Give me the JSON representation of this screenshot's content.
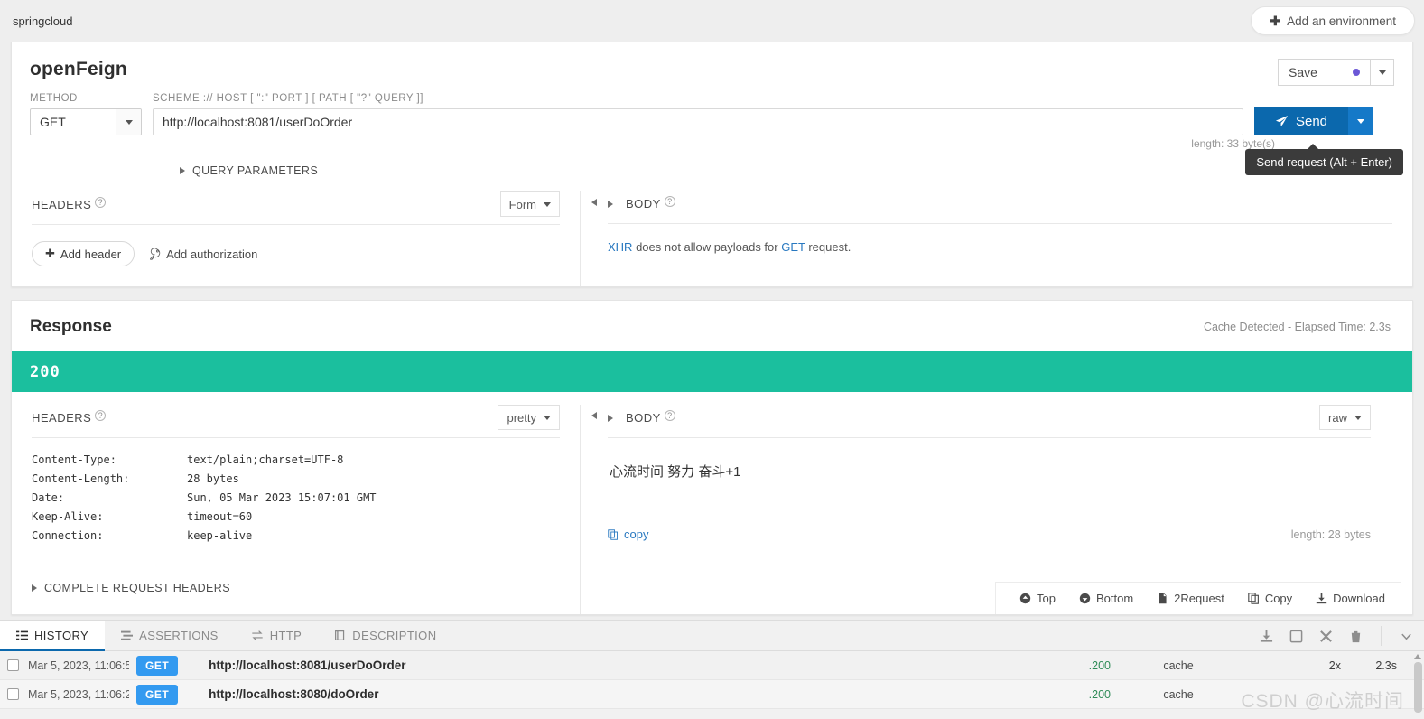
{
  "topbar": {
    "workspace": "springcloud",
    "add_environment": "Add an environment"
  },
  "request": {
    "title": "openFeign",
    "save_label": "Save",
    "method_label": "METHOD",
    "method_value": "GET",
    "url_label": "SCHEME :// HOST [ \":\" PORT ] [ PATH [ \"?\" QUERY ]]",
    "url_value": "http://localhost:8081/userDoOrder",
    "send_label": "Send",
    "send_tooltip": "Send request (Alt + Enter)",
    "length_note": "length: 33 byte(s)",
    "query_parameters": "QUERY PARAMETERS",
    "headers": {
      "title": "HEADERS",
      "view_mode": "Form",
      "add_header": "Add header",
      "add_authorization": "Add authorization"
    },
    "body": {
      "title": "BODY",
      "note_prefix": "XHR",
      "note_middle": " does not allow payloads for ",
      "note_method": "GET",
      "note_suffix": " request."
    }
  },
  "response": {
    "title": "Response",
    "meta": "Cache Detected - Elapsed Time: 2.3s",
    "status_code": "200",
    "headers": {
      "title": "HEADERS",
      "view_mode": "pretty",
      "rows": [
        {
          "key": "Content-Type:",
          "value": "text/plain;charset=UTF-8"
        },
        {
          "key": "Content-Length:",
          "value": "28 bytes"
        },
        {
          "key": "Date:",
          "value": "Sun, 05 Mar 2023 15:07:01 GMT"
        },
        {
          "key": "Keep-Alive:",
          "value": "timeout=60"
        },
        {
          "key": "Connection:",
          "value": "keep-alive"
        }
      ],
      "complete_request_headers": "COMPLETE REQUEST HEADERS"
    },
    "body": {
      "title": "BODY",
      "view_mode": "raw",
      "content": "心流时间 努力 奋斗+1",
      "copy_label": "copy",
      "length": "length: 28 bytes"
    },
    "footer": [
      {
        "label": "Top",
        "icon": "arrow-up-circle-icon"
      },
      {
        "label": "Bottom",
        "icon": "arrow-down-circle-icon"
      },
      {
        "label": "2Request",
        "icon": "request-icon"
      },
      {
        "label": "Copy",
        "icon": "copy-icon"
      },
      {
        "label": "Download",
        "icon": "download-icon"
      }
    ]
  },
  "history": {
    "tabs": [
      {
        "label": "HISTORY",
        "icon": "list-icon",
        "active": true
      },
      {
        "label": "ASSERTIONS",
        "icon": "assertions-icon",
        "active": false
      },
      {
        "label": "HTTP",
        "icon": "exchange-icon",
        "active": false
      },
      {
        "label": "DESCRIPTION",
        "icon": "book-icon",
        "active": false
      }
    ],
    "tools": [
      "download-icon",
      "select-all-icon",
      "clear-icon",
      "trash-icon",
      "chevron-down-icon"
    ],
    "rows": [
      {
        "time": "Mar 5, 2023, 11:06:5",
        "method": "GET",
        "url": "http://localhost:8081/userDoOrder",
        "status": ".200",
        "cache": "cache",
        "times": "2x",
        "duration": "2.3s"
      },
      {
        "time": "Mar 5, 2023, 11:06:2",
        "method": "GET",
        "url": "http://localhost:8080/doOrder",
        "status": ".200",
        "cache": "cache",
        "times": "",
        "duration": ""
      }
    ]
  },
  "watermark": "CSDN @心流时间",
  "colors": {
    "status_green": "#1bbf9e",
    "send_blue": "#0b68ad",
    "badge_blue": "#339af0",
    "link_blue": "#2878c0",
    "save_dot": "#6b57d6"
  }
}
